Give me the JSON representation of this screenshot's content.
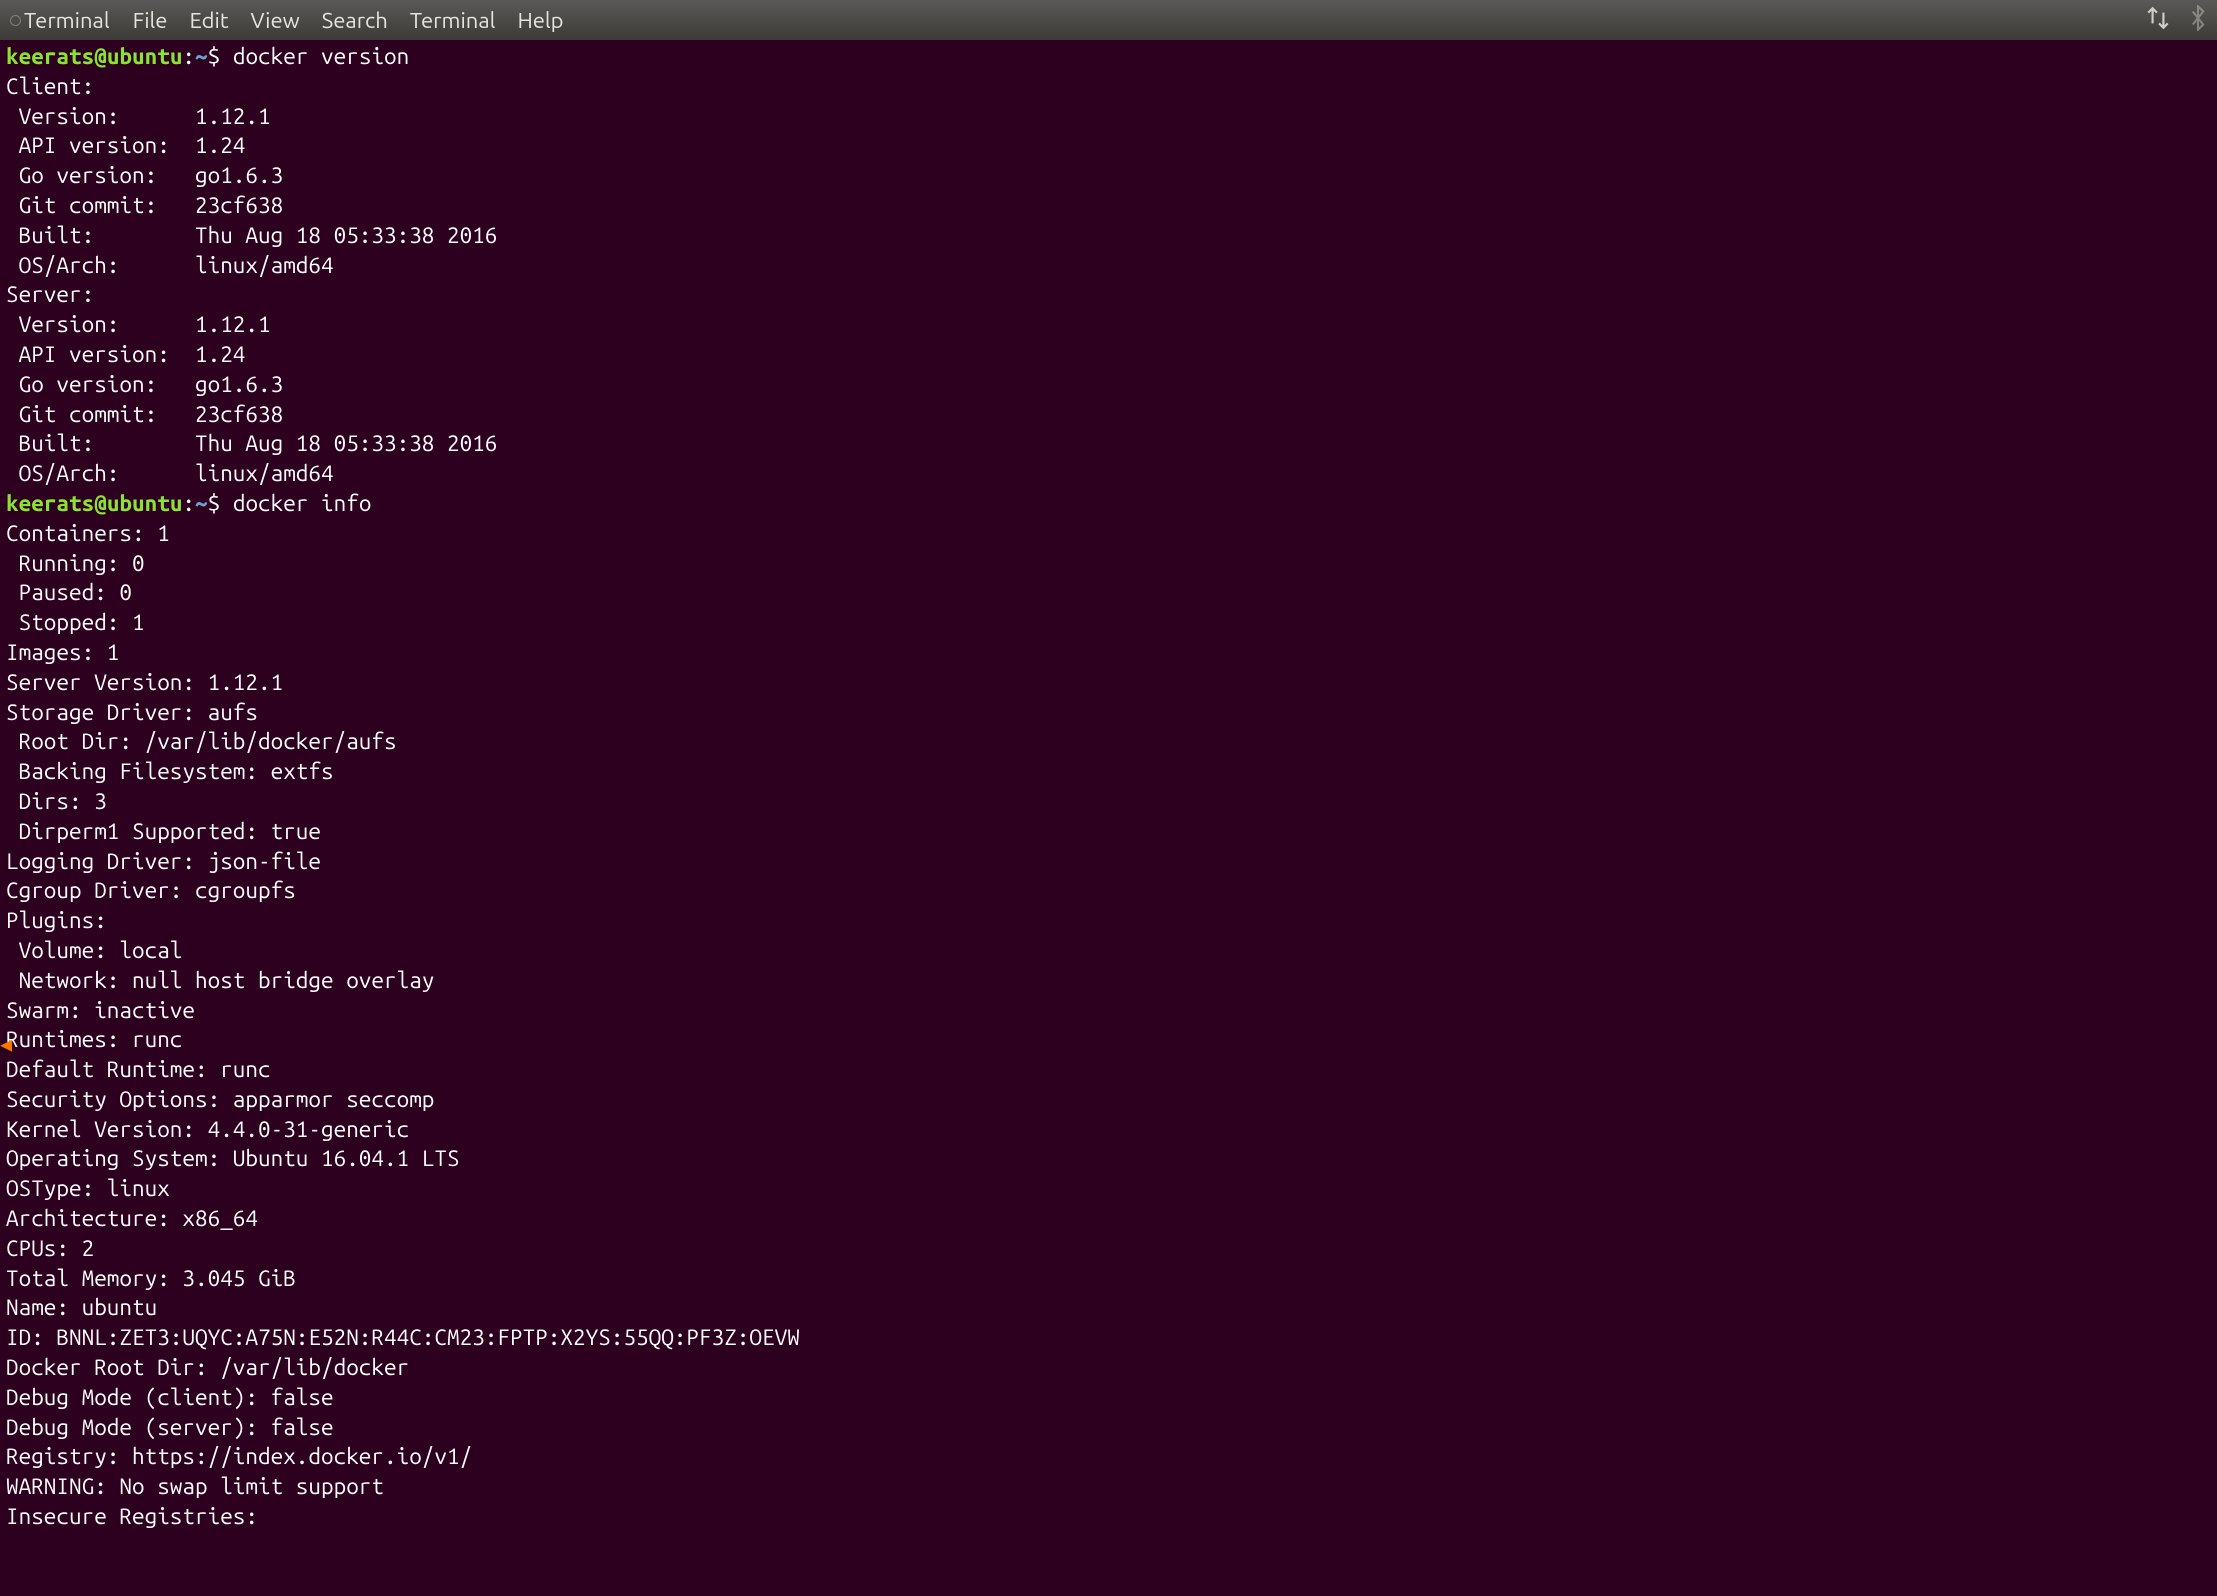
{
  "menubar": {
    "app_title": "Terminal",
    "items": [
      "File",
      "Edit",
      "View",
      "Search",
      "Terminal",
      "Help"
    ],
    "tray": [
      "network-transfer-icon",
      "bluetooth-icon"
    ]
  },
  "prompt": {
    "user": "keerats",
    "host": "ubuntu",
    "path": "~",
    "sign": "$"
  },
  "commands": {
    "cmd1": "docker version",
    "cmd2": "docker info"
  },
  "block1": {
    "l0": "Client:",
    "l1": " Version:      1.12.1",
    "l2": " API version:  1.24",
    "l3": " Go version:   go1.6.3",
    "l4": " Git commit:   23cf638",
    "l5": " Built:        Thu Aug 18 05:33:38 2016",
    "l6": " OS/Arch:      linux/amd64",
    "l7": "",
    "l8": "Server:",
    "l9": " Version:      1.12.1",
    "l10": " API version:  1.24",
    "l11": " Go version:   go1.6.3",
    "l12": " Git commit:   23cf638",
    "l13": " Built:        Thu Aug 18 05:33:38 2016",
    "l14": " OS/Arch:      linux/amd64"
  },
  "block2": {
    "l0": "Containers: 1",
    "l1": " Running: 0",
    "l2": " Paused: 0",
    "l3": " Stopped: 1",
    "l4": "Images: 1",
    "l5": "Server Version: 1.12.1",
    "l6": "Storage Driver: aufs",
    "l7": " Root Dir: /var/lib/docker/aufs",
    "l8": " Backing Filesystem: extfs",
    "l9": " Dirs: 3",
    "l10": " Dirperm1 Supported: true",
    "l11": "Logging Driver: json-file",
    "l12": "Cgroup Driver: cgroupfs",
    "l13": "Plugins:",
    "l14": " Volume: local",
    "l15": " Network: null host bridge overlay",
    "l16": "Swarm: inactive",
    "l17": "Runtimes: runc",
    "l18": "Default Runtime: runc",
    "l19": "Security Options: apparmor seccomp",
    "l20": "Kernel Version: 4.4.0-31-generic",
    "l21": "Operating System: Ubuntu 16.04.1 LTS",
    "l22": "OSType: linux",
    "l23": "Architecture: x86_64",
    "l24": "CPUs: 2",
    "l25": "Total Memory: 3.045 GiB",
    "l26": "Name: ubuntu",
    "l27": "ID: BNNL:ZET3:UQYC:A75N:E52N:R44C:CM23:FPTP:X2YS:55QQ:PF3Z:OEVW",
    "l28": "Docker Root Dir: /var/lib/docker",
    "l29": "Debug Mode (client): false",
    "l30": "Debug Mode (server): false",
    "l31": "Registry: https://index.docker.io/v1/",
    "l32": "WARNING: No swap limit support",
    "l33": "Insecure Registries:"
  }
}
